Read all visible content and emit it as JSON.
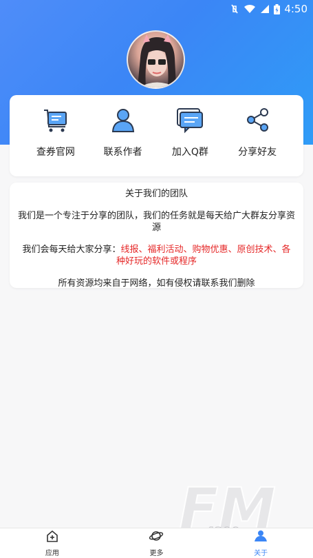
{
  "status_bar": {
    "time": "4:50"
  },
  "links": [
    {
      "label": "查券官网",
      "icon": "cart-icon"
    },
    {
      "label": "联系作者",
      "icon": "user-icon"
    },
    {
      "label": "加入Q群",
      "icon": "chat-icon"
    },
    {
      "label": "分享好友",
      "icon": "share-icon"
    }
  ],
  "about": {
    "title": "关于我们的团队",
    "p1": "我们是一个专注于分享的团队，我们的任务就是每天给广大群友分享资源",
    "p2_prefix": "我们会每天给大家分享：",
    "p2_highlight": "线报、福利活动、购物优惠、原创技术、各种好玩的软件或程序",
    "p3": "所有资源均来自于网络，如有侵权请联系我们删除"
  },
  "tabs": [
    {
      "label": "应用",
      "icon": "home-add-icon"
    },
    {
      "label": "更多",
      "icon": "planet-icon"
    },
    {
      "label": "关于",
      "icon": "user-cloud-icon",
      "active": true
    }
  ],
  "colors": {
    "primary": "#3b86f6",
    "highlight": "#e52727"
  }
}
